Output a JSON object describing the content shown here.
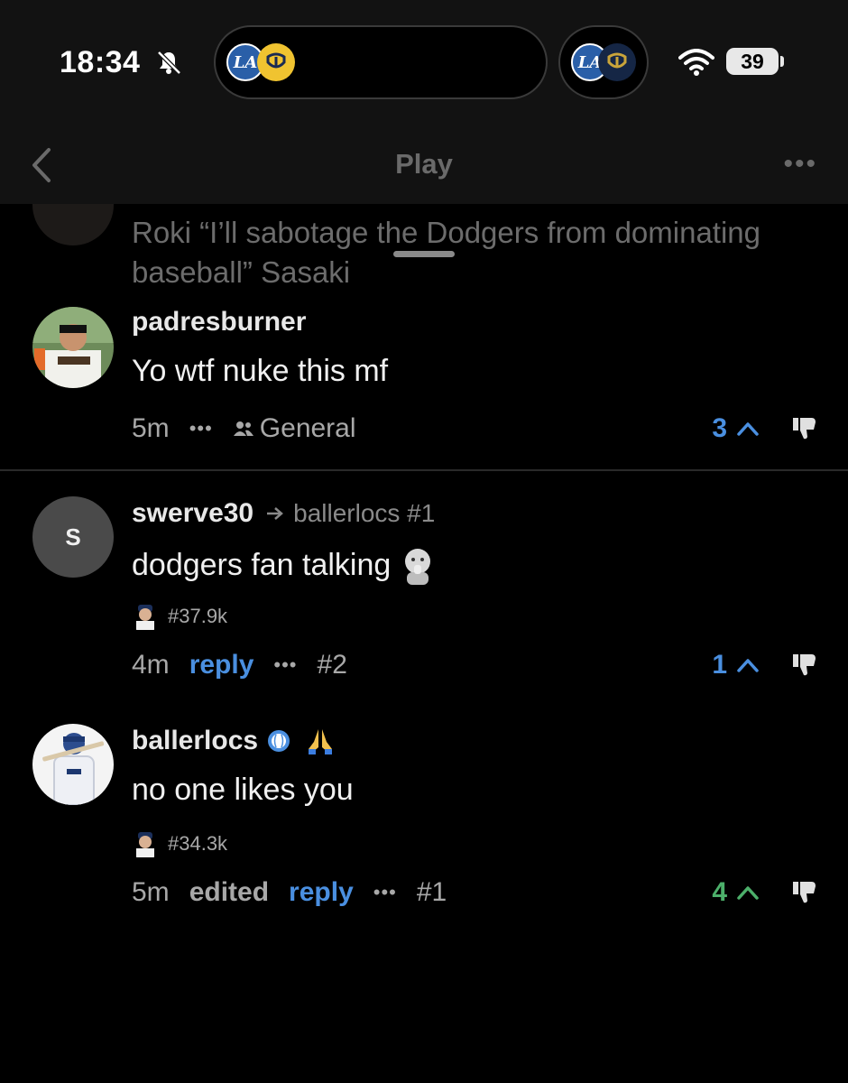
{
  "status": {
    "time": "18:34",
    "battery": "39",
    "live_left_teams": [
      "LA",
      "MIL"
    ],
    "live_right_teams": [
      "LA",
      "MIL"
    ]
  },
  "header": {
    "title": "Play",
    "more_label": "•••"
  },
  "faded_comment": {
    "text": "Roki “I’ll sabotage the Dodgers from dominating baseball” Sasaki"
  },
  "comments": [
    {
      "username": "padresburner",
      "text": "Yo wtf nuke this mf",
      "time": "5m",
      "more": "•••",
      "channel": "General",
      "votes": "3",
      "vote_color": "#4a8fe0"
    },
    {
      "username": "swerve30",
      "avatar_initial": "S",
      "reply_to": "ballerlocs #1",
      "text": "dodgers fan talking",
      "flair": "#37.9k",
      "time": "4m",
      "reply_label": "reply",
      "more": "•••",
      "number": "#2",
      "votes": "1",
      "vote_color": "#4a8fe0"
    },
    {
      "username": "ballerlocs",
      "text": "no one likes you",
      "flair": "#34.3k",
      "time": "5m",
      "edited_label": "edited",
      "reply_label": "reply",
      "more": "•••",
      "number": "#1",
      "votes": "4",
      "vote_color": "#4caf6a"
    }
  ]
}
